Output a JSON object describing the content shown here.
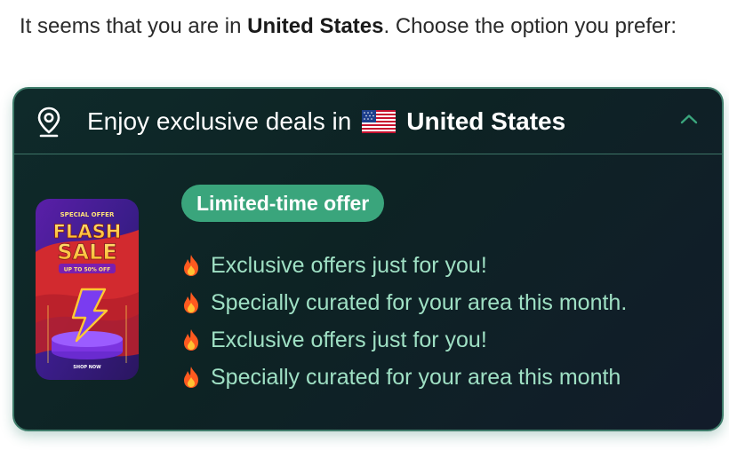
{
  "intro": {
    "prefix": "It seems that you are in ",
    "country": "United States",
    "suffix": ". Choose the option you prefer:"
  },
  "card": {
    "icon": "location-pin-icon",
    "header_prefix": "Enjoy exclusive deals in",
    "flag": "us-flag",
    "header_country": "United States",
    "collapse_icon": "chevron-up-icon",
    "accent_color": "#3aa57c",
    "promo_image": {
      "top_text": "SPECIAL OFFER",
      "flash": "FLASH",
      "sale": "SALE",
      "discount": "UP TO 50% OFF",
      "cta": "SHOP NOW"
    },
    "badge": "Limited-time offer",
    "features": [
      {
        "icon": "fire-icon",
        "text": "Exclusive offers just for you!"
      },
      {
        "icon": "fire-icon",
        "text": "Specially curated for your area this month."
      },
      {
        "icon": "fire-icon",
        "text": "Exclusive offers just for you!"
      },
      {
        "icon": "fire-icon",
        "text": "Specially curated for your area this month"
      }
    ]
  }
}
